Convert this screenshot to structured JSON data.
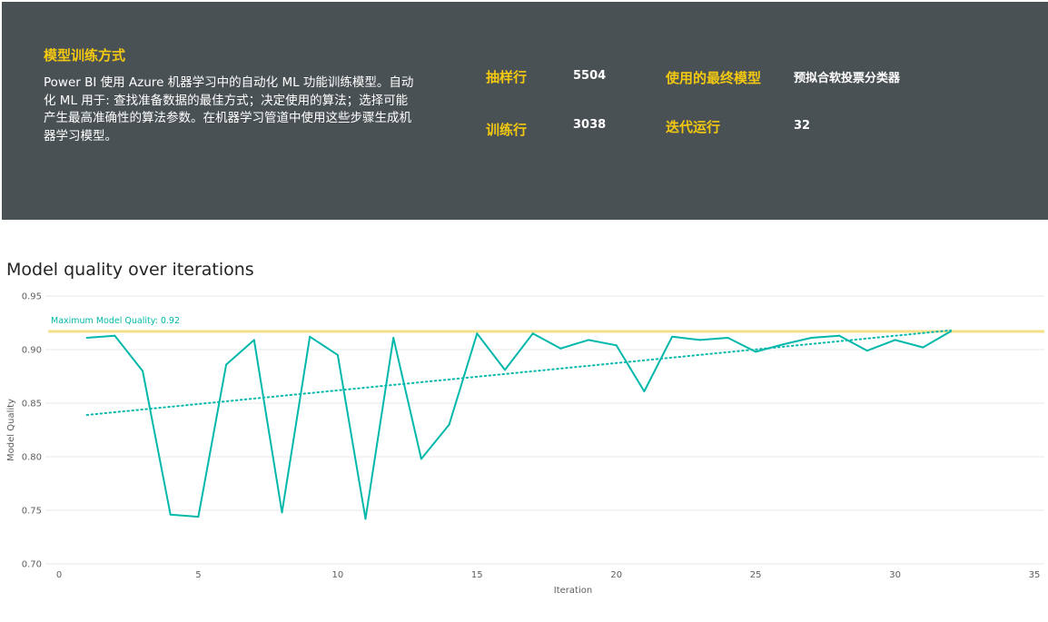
{
  "banner": {
    "title": "模型训练方式",
    "description": "Power BI 使用 Azure 机器学习中的自动化 ML 功能训练模型。自动化 ML 用于: 查找准备数据的最佳方式；决定使用的算法；选择可能产生最高准确性的算法参数。在机器学习管道中使用这些步骤生成机器学习模型。",
    "metrics": {
      "sampled_rows_label": "抽样行",
      "sampled_rows_value": "5504",
      "training_rows_label": "训练行",
      "training_rows_value": "3038",
      "final_model_label": "使用的最终模型",
      "final_model_value": "预拟合软投票分类器",
      "iterations_label": "迭代运行",
      "iterations_value": "32"
    }
  },
  "chart": {
    "title": "Model quality over iterations"
  },
  "chart_data": {
    "type": "line",
    "xlabel": "Iteration",
    "ylabel": "Model Quality",
    "xlim": [
      0,
      35
    ],
    "ylim": [
      0.7,
      0.95
    ],
    "xticks": [
      "0",
      "5",
      "10",
      "15",
      "20",
      "25",
      "30",
      "35"
    ],
    "yticks": [
      "0.70",
      "0.75",
      "0.80",
      "0.85",
      "0.90",
      "0.95"
    ],
    "grid": true,
    "reference_line": {
      "label": "Maximum Model Quality: 0.92",
      "value": 0.917,
      "color": "#f5e08a"
    },
    "trendline": {
      "start": [
        1,
        0.839
      ],
      "end": [
        32,
        0.918
      ],
      "style": "dotted"
    },
    "series": [
      {
        "color": "#01b8aa",
        "x": [
          1,
          2,
          3,
          4,
          5,
          6,
          7,
          8,
          9,
          10,
          11,
          12,
          13,
          14,
          15,
          16,
          17,
          18,
          19,
          20,
          21,
          22,
          23,
          24,
          25,
          26,
          27,
          28,
          29,
          30,
          31,
          32
        ],
        "values": [
          0.911,
          0.913,
          0.88,
          0.746,
          0.744,
          0.886,
          0.909,
          0.748,
          0.912,
          0.895,
          0.742,
          0.911,
          0.798,
          0.83,
          0.915,
          0.881,
          0.915,
          0.901,
          0.909,
          0.904,
          0.861,
          0.912,
          0.909,
          0.911,
          0.898,
          0.905,
          0.911,
          0.913,
          0.899,
          0.909,
          0.902,
          0.917
        ]
      }
    ]
  }
}
